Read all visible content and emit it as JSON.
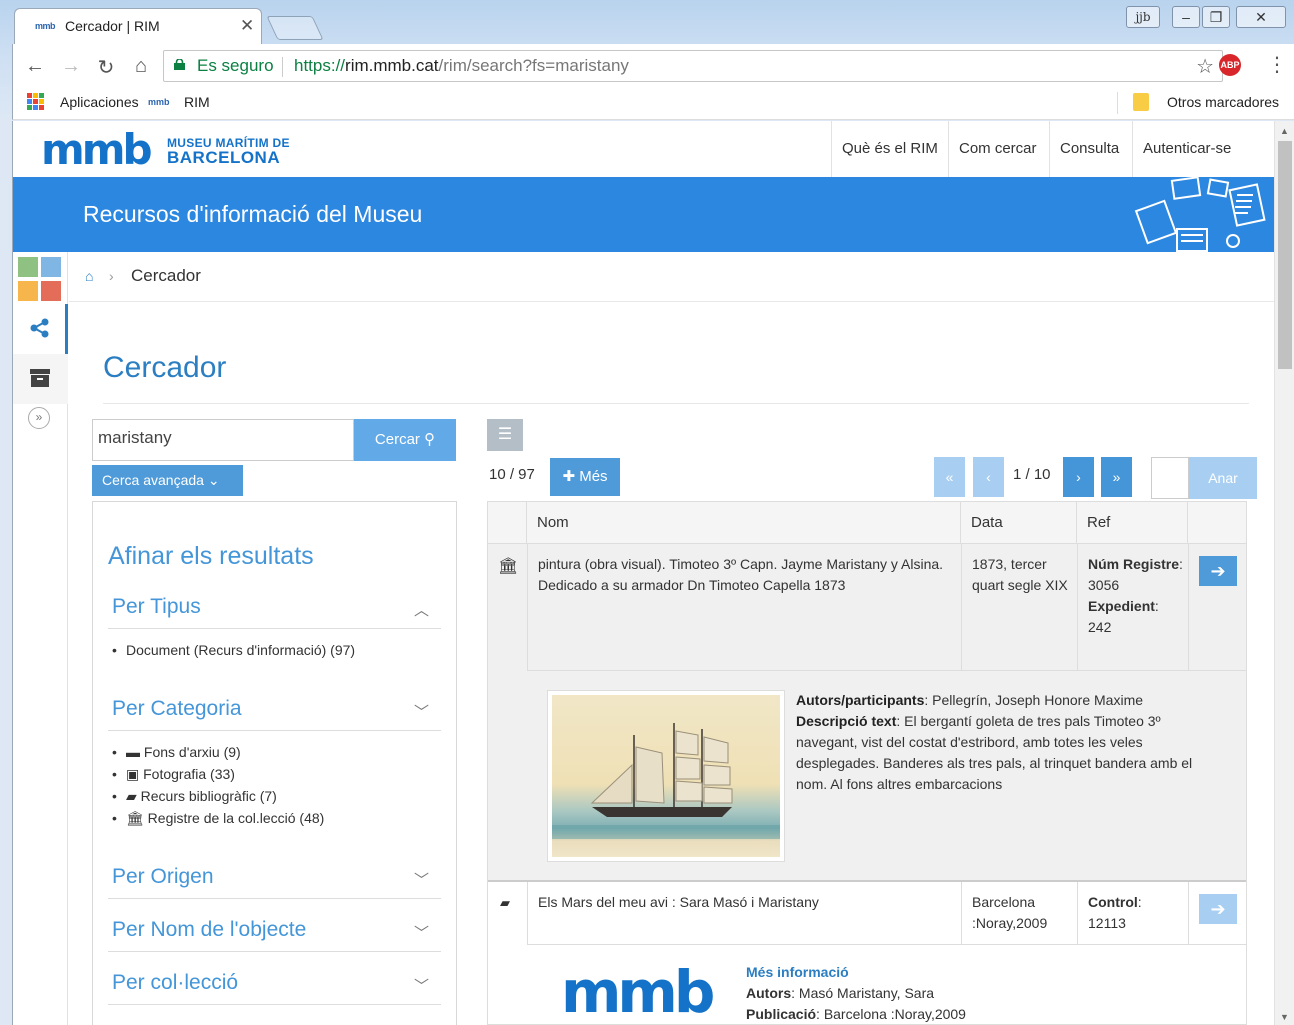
{
  "browser": {
    "tab_title": "Cercador | RIM",
    "tab_favicon": "mmb",
    "security_label": "Es seguro",
    "url_scheme": "https://",
    "url_host": "rim.mmb.cat",
    "url_path": "/rim/search?fs=maristany",
    "bookmarks": [
      "Aplicaciones",
      "RIM"
    ],
    "bookmark_rim_favicon": "mmb",
    "other_bookmarks": "Otros marcadores",
    "window_badge": "jjb",
    "abp_label": "ABP"
  },
  "site": {
    "logo_main": "mmb",
    "logo_line1": "MUSEU MARÍTIM DE",
    "logo_line2": "BARCELONA",
    "nav": [
      "Què és el RIM",
      "Com cercar",
      "Consulta",
      "Autenticar-se"
    ],
    "banner_title": "Recursos d'informació del Museu"
  },
  "breadcrumb": {
    "current": "Cercador"
  },
  "page_title": "Cercador",
  "search": {
    "value": "maristany",
    "button": "Cercar",
    "advanced": "Cerca avançada"
  },
  "facets": {
    "title": "Afinar els resultats",
    "groups": [
      {
        "label": "Per Tipus",
        "expanded": true,
        "items": [
          "Document (Recurs d'informació) (97)"
        ]
      },
      {
        "label": "Per Categoria",
        "expanded": true,
        "items": [
          "Fons d'arxiu (9)",
          "Fotografia (33)",
          "Recurs bibliogràfic (7)",
          "Registre de la col.lecció (48)"
        ]
      },
      {
        "label": "Per Origen",
        "expanded": false
      },
      {
        "label": "Per Nom de l'objecte",
        "expanded": false
      },
      {
        "label": "Per col·lecció",
        "expanded": false
      }
    ]
  },
  "results": {
    "count": "10 / 97",
    "more_button": "Més",
    "page_indicator": "1 / 10",
    "go_button": "Anar",
    "columns": [
      "Nom",
      "Data",
      "Ref"
    ],
    "items": [
      {
        "type_icon": "museum-icon",
        "name": "pintura (obra visual). Timoteo 3º Capn. Jayme Maristany y Alsina. Dedicado a su armador Dn Timoteo Capella 1873",
        "date": "1873, tercer quart segle XIX",
        "ref_label1": "Núm Registre",
        "ref_value1": "3056",
        "ref_label2": "Expedient",
        "ref_value2": "242",
        "authors_label": "Autors/participants",
        "authors": "Pellegrín, Joseph Honore Maxime",
        "desc_label": "Descripció text",
        "desc": "El bergantí goleta de tres pals Timoteo 3º navegant, vist del costat d'estribord, amb totes les veles desplegades. Banderes als tres pals, al trinquet bandera amb el nom. Al fons altres embarcacions"
      },
      {
        "type_icon": "book-icon",
        "name": "Els Mars del meu avi : Sara Masó i Maristany",
        "date": "Barcelona :Noray,2009",
        "ref_label1": "Control",
        "ref_value1": "12113",
        "more_info": "Més informació",
        "authors_label": "Autors",
        "authors": "Masó Maristany, Sara",
        "pub_label": "Publicació",
        "pub": "Barcelona :Noray,2009"
      }
    ]
  },
  "colors": {
    "brand": "#1473c9",
    "banner": "#2c87e0",
    "accent": "#4f9ad8"
  }
}
